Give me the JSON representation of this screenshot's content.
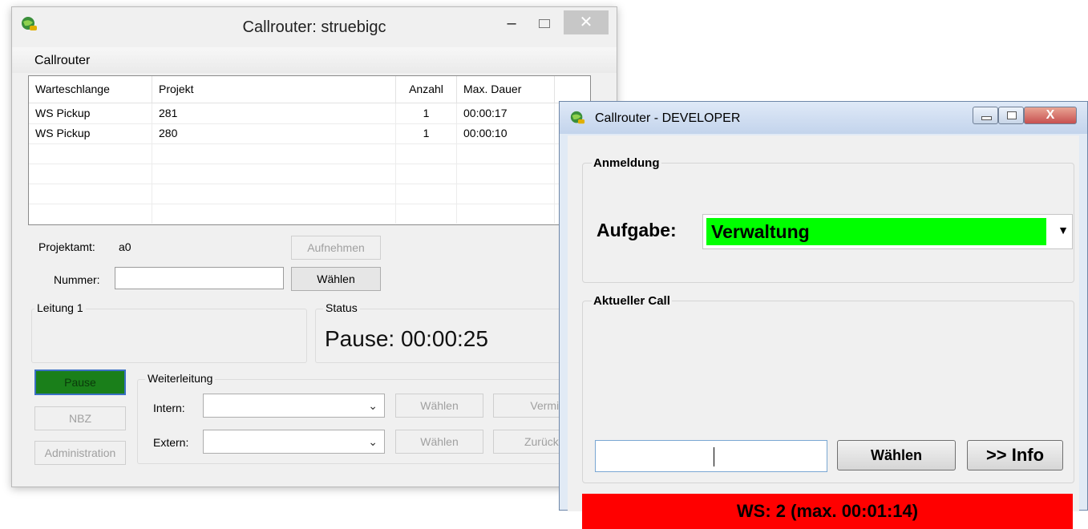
{
  "window1": {
    "title": "Callrouter: struebigc",
    "controls": {
      "minimize": "–",
      "close": "✕"
    },
    "menu": [
      "Callrouter"
    ],
    "table": {
      "columns": [
        "Warteschlange",
        "Projekt",
        "Anzahl",
        "Max. Dauer"
      ],
      "rows": [
        [
          "WS Pickup",
          "281",
          "1",
          "00:00:17"
        ],
        [
          "WS Pickup",
          "280",
          "1",
          "00:00:10"
        ]
      ]
    },
    "projektamt_label": "Projektamt:",
    "projektamt_value": "a0",
    "aufnehmen_button": "Aufnehmen",
    "nummer_label": "Nummer:",
    "nummer_value": "",
    "waehlen_button": "Wählen",
    "leitung_title": "Leitung 1",
    "status_title": "Status",
    "status_text": "Pause: 00:00:25",
    "pause_button": "Pause",
    "nbz_button": "NBZ",
    "administration_button": "Administration",
    "weiterleitung_title": "Weiterleitung",
    "intern_label": "Intern:",
    "extern_label": "Extern:",
    "intern_waehlen": "Wählen",
    "extern_waehlen": "Wählen",
    "vermitteln_button": "Vermitteln",
    "zurueckholen_button": "Zurückholen",
    "colors": {
      "pause_green": "#1a7f1a",
      "close_bg": "#c7c7c7"
    }
  },
  "window2": {
    "title": "Callrouter - DEVELOPER",
    "close_glyph": "X",
    "anmeldung_title": "Anmeldung",
    "aufgabe_label": "Aufgabe:",
    "aufgabe_value": "Verwaltung",
    "aktueller_call_title": "Aktueller Call",
    "call_input_value": "",
    "waehlen_button": "Wählen",
    "info_button": ">> Info",
    "ws_status": "WS: 2 (max. 00:01:14)",
    "colors": {
      "aufgabe_bg": "#00ff00",
      "ws_bar": "#ff0000"
    }
  }
}
